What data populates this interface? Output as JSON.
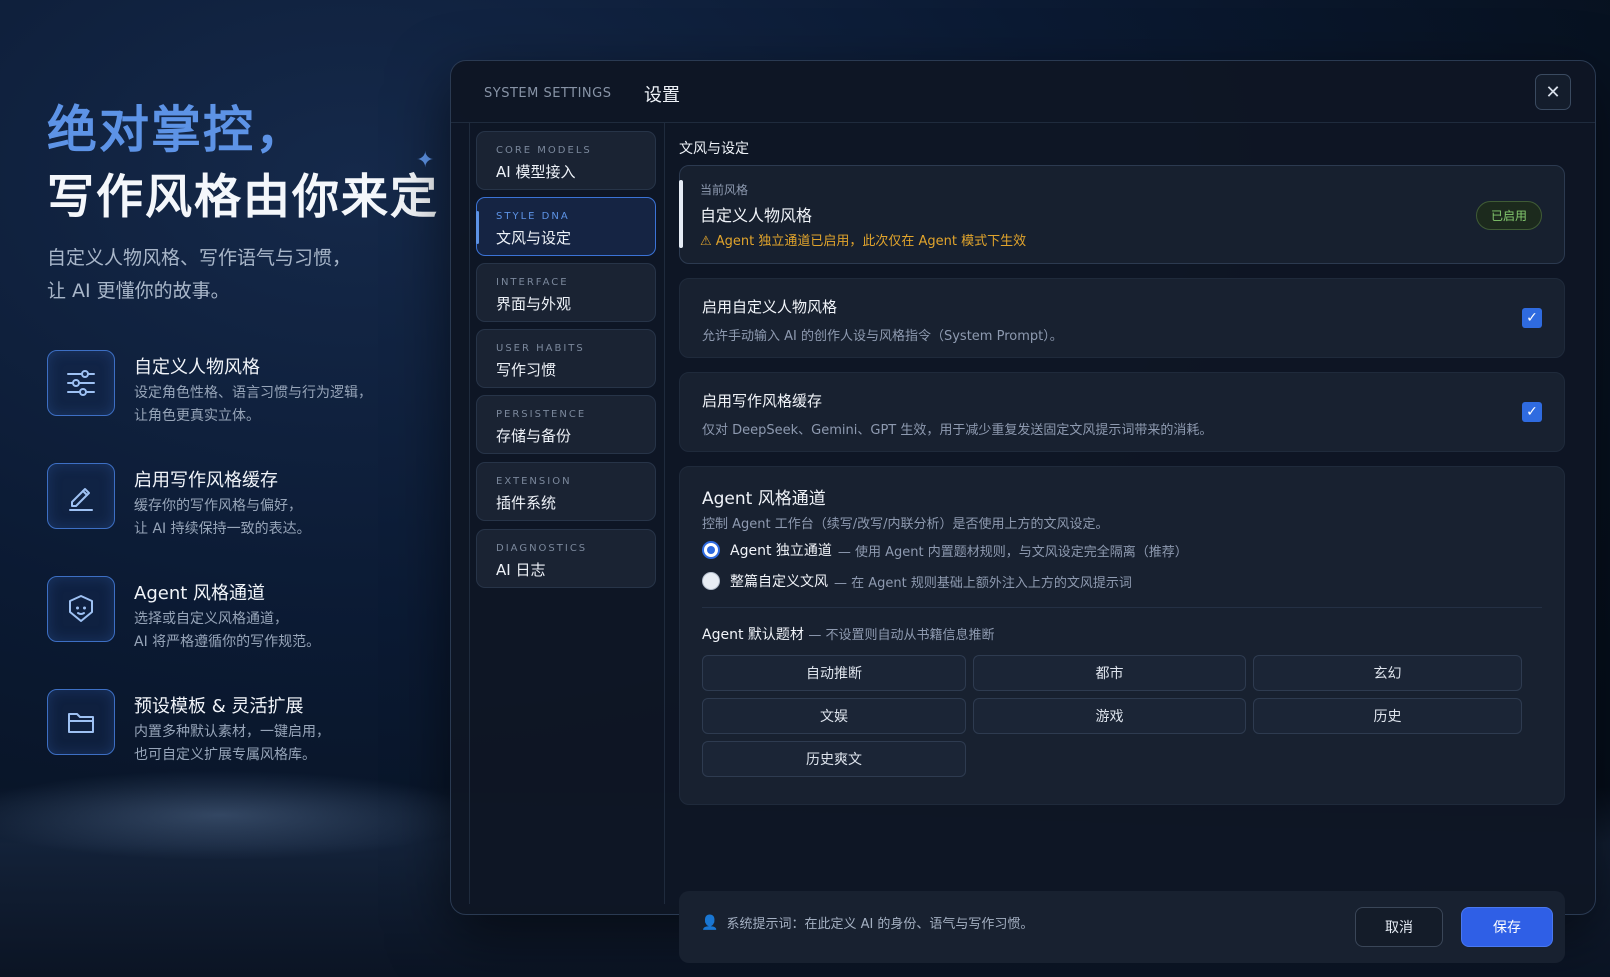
{
  "hero": {
    "title_line1": "绝对掌控，",
    "title_line2": "写作风格由你来定",
    "subtitle_line1": "自定义人物风格、写作语气与习惯，",
    "subtitle_line2": "让 AI 更懂你的故事。"
  },
  "features": [
    {
      "icon": "sliders-icon",
      "title": "自定义人物风格",
      "desc1": "设定角色性格、语言习惯与行为逻辑，",
      "desc2": "让角色更真实立体。"
    },
    {
      "icon": "pen-icon",
      "title": "启用写作风格缓存",
      "desc1": "缓存你的写作风格与偏好，",
      "desc2": "让 AI 持续保持一致的表达。"
    },
    {
      "icon": "shield-face-icon",
      "title": "Agent 风格通道",
      "desc1": "选择或自定义风格通道，",
      "desc2": "AI 将严格遵循你的写作规范。"
    },
    {
      "icon": "folder-icon",
      "title": "预设模板 & 灵活扩展",
      "desc1": "内置多种默认素材，一键启用，",
      "desc2": "也可自定义扩展专属风格库。"
    }
  ],
  "panel": {
    "system_label": "SYSTEM SETTINGS",
    "title": "设置",
    "close_icon": "close-icon"
  },
  "sidebar": {
    "items": [
      {
        "en": "CORE MODELS",
        "zh": "AI 模型接入",
        "active": false
      },
      {
        "en": "STYLE DNA",
        "zh": "文风与设定",
        "active": true
      },
      {
        "en": "INTERFACE",
        "zh": "界面与外观",
        "active": false
      },
      {
        "en": "USER HABITS",
        "zh": "写作习惯",
        "active": false
      },
      {
        "en": "PERSISTENCE",
        "zh": "存储与备份",
        "active": false
      },
      {
        "en": "EXTENSION",
        "zh": "插件系统",
        "active": false
      },
      {
        "en": "DIAGNOSTICS",
        "zh": "AI 日志",
        "active": false
      }
    ]
  },
  "content": {
    "section_title": "文风与设定",
    "current": {
      "label": "当前风格",
      "value": "自定义人物风格",
      "warning": "⚠ Agent 独立通道已启用，此次仅在 Agent 模式下生效",
      "badge": "已启用"
    },
    "toggle_custom": {
      "title": "启用自定义人物风格",
      "desc": "允许手动输入 AI 的创作人设与风格指令（System Prompt）。",
      "checked": true
    },
    "toggle_cache": {
      "title": "启用写作风格缓存",
      "desc": "仅对 DeepSeek、Gemini、GPT 生效，用于减少重复发送固定文风提示词带来的消耗。",
      "checked": true
    },
    "agent": {
      "title": "Agent 风格通道",
      "desc": "控制 Agent 工作台（续写/改写/内联分析）是否使用上方的文风设定。",
      "options": [
        {
          "label": "Agent 独立通道",
          "hint": "— 使用 Agent 内置题材规则，与文风设定完全隔离（推荐）",
          "selected": true
        },
        {
          "label": "整篇自定义文风",
          "hint": "— 在 Agent 规则基础上额外注入上方的文风提示词",
          "selected": false
        }
      ],
      "genre_title": "Agent 默认题材",
      "genre_hint": "— 不设置则自动从书籍信息推断",
      "genres": [
        "自动推断",
        "都市",
        "玄幻",
        "文娱",
        "游戏",
        "历史",
        "历史爽文"
      ]
    },
    "footer": {
      "hint": "系统提示词：在此定义 AI 的身份、语气与写作习惯。",
      "cancel": "取消",
      "save": "保存"
    }
  },
  "colors": {
    "accent": "#2f6be0",
    "hero_blue": "#5d93e6",
    "warning": "#e1a42c",
    "badge_green": "#83c96e"
  }
}
